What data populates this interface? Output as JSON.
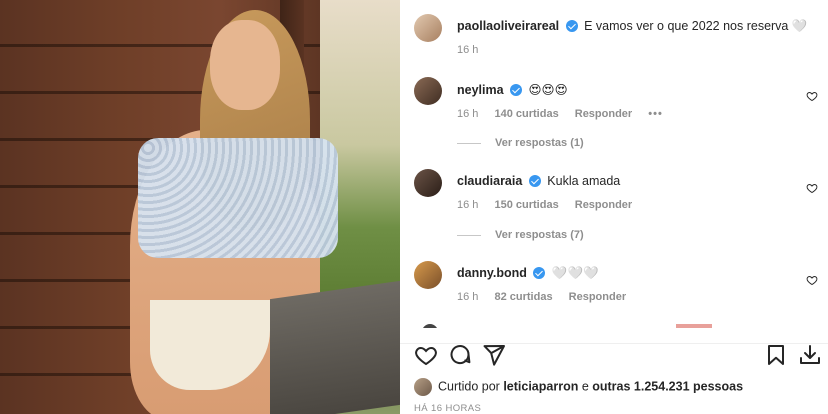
{
  "post": {
    "author": "paollaoliveirareal",
    "caption": "E vamos ver o que 2022 nos reserva 🤍",
    "time": "16 h"
  },
  "comments": [
    {
      "user": "neylima",
      "text": "😍😍😍",
      "time": "16 h",
      "likes": "140 curtidas",
      "reply": "Responder",
      "more": "•••",
      "replies": "Ver respostas (1)"
    },
    {
      "user": "claudiaraia",
      "text": "Kukla amada",
      "time": "16 h",
      "likes": "150 curtidas",
      "reply": "Responder",
      "replies": "Ver respostas (7)"
    },
    {
      "user": "danny.bond",
      "text": "🤍🤍🤍",
      "time": "16 h",
      "likes": "82 curtidas",
      "reply": "Responder"
    }
  ],
  "liked_by": {
    "prefix": "Curtido por ",
    "user": "leticiaparron",
    "middle": " e ",
    "others": "outras 1.254.231 pessoas"
  },
  "timestamp": "HÁ 16 HORAS",
  "icons": [
    "heart-icon",
    "comment-icon",
    "share-icon",
    "bookmark-icon",
    "download-icon"
  ],
  "colors": {
    "verified": "#3897f0",
    "muted": "#8e8e8e",
    "text": "#262626"
  }
}
